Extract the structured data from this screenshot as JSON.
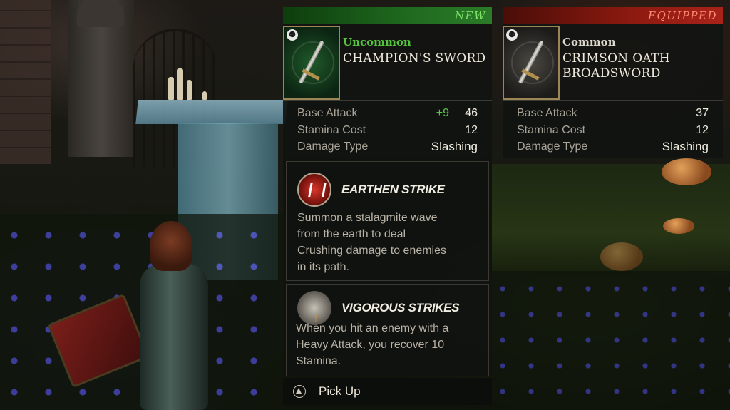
{
  "new_item": {
    "tag": "NEW",
    "rarity": "Uncommon",
    "name": "CHAMPION'S SWORD",
    "icon": "sword-icon",
    "stats": [
      {
        "label": "Base Attack",
        "bonus": "+9",
        "value": "46"
      },
      {
        "label": "Stamina Cost",
        "value": "12"
      },
      {
        "label": "Damage Type",
        "value": "Slashing"
      }
    ],
    "abilities": [
      {
        "icon": "earthen-strike-icon",
        "title": "EARTHEN STRIKE",
        "lines": [
          "Summon a stalagmite wave",
          "from the earth to deal",
          "Crushing damage to enemies",
          "in its path."
        ]
      },
      {
        "icon": "vigorous-strikes-icon",
        "title": "VIGOROUS STRIKES",
        "lines": [
          "When you hit an enemy with a",
          "Heavy Attack, you recover 10",
          "Stamina."
        ]
      }
    ],
    "action": {
      "button_icon": "triangle-button-icon",
      "label": "Pick Up"
    }
  },
  "equipped_item": {
    "tag": "EQUIPPED",
    "rarity": "Common",
    "name_lines": [
      "CRIMSON OATH",
      "BROADSWORD"
    ],
    "icon": "sword-icon",
    "stats": [
      {
        "label": "Base Attack",
        "value": "37"
      },
      {
        "label": "Stamina Cost",
        "value": "12"
      },
      {
        "label": "Damage Type",
        "value": "Slashing"
      }
    ]
  },
  "colors": {
    "new_accent": "#2b7b28",
    "equipped_accent": "#a8231a",
    "uncommon_text": "#55c33e",
    "bonus_text": "#5cc54a"
  }
}
